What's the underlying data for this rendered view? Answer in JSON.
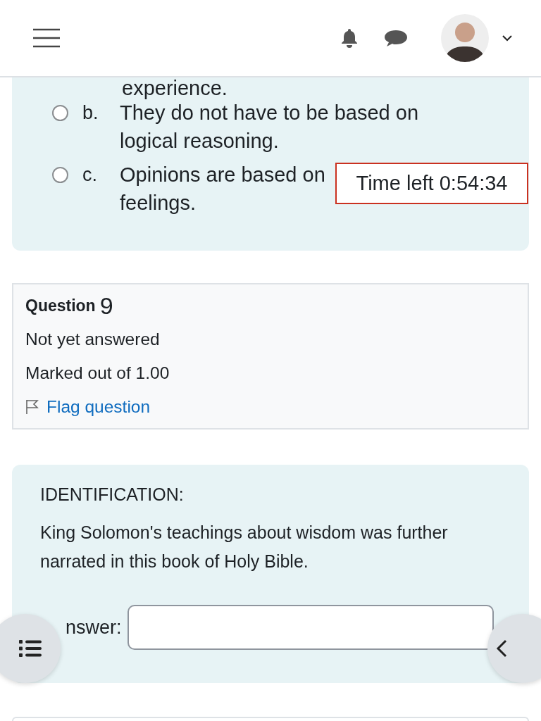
{
  "previous_question": {
    "top_text": "experience.",
    "options": [
      {
        "letter": "b.",
        "lines": [
          "They do not have to be based on",
          "logical reasoning."
        ],
        "selected": false
      },
      {
        "letter": "c.",
        "lines": [
          "Opinions are based on",
          "feelings."
        ],
        "selected": false
      }
    ]
  },
  "timer": "Time left 0:54:34",
  "question_info": {
    "label": "Question",
    "number": "9",
    "status": "Not yet answered",
    "marks": "Marked out of 1.00",
    "flag": "Flag question",
    "flagged": false
  },
  "question": {
    "heading": "IDENTIFICATION:",
    "text": "King Solomon's teachings about wisdom was further narrated in this book of Holy Bible.",
    "answer_label": "nswer:"
  }
}
